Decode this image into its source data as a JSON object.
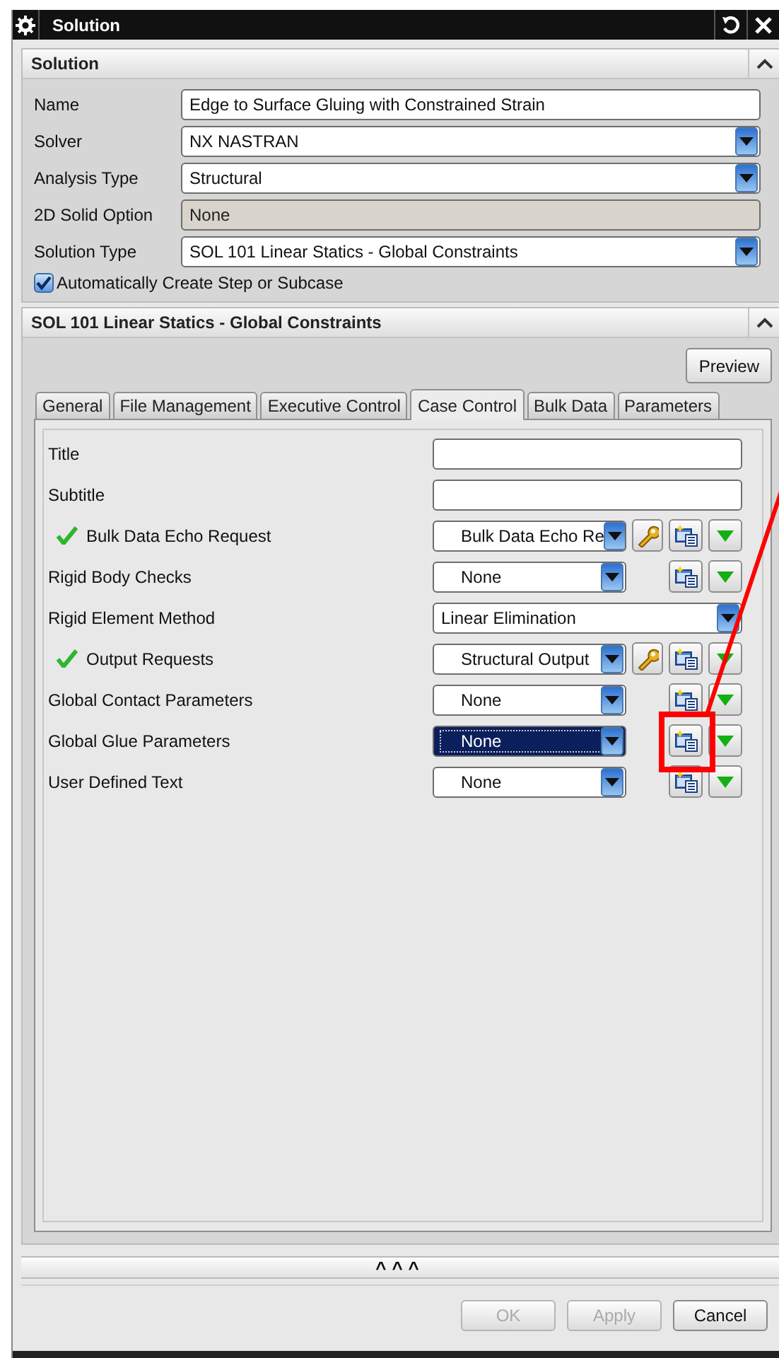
{
  "window": {
    "title": "Solution"
  },
  "solution_section": {
    "title": "Solution",
    "expanded": true,
    "fields": [
      {
        "label": "Name",
        "kind": "text",
        "value": "Edge to Surface Gluing with Constrained Strain",
        "disabled": false
      },
      {
        "label": "Solver",
        "kind": "dropdown",
        "value": "NX NASTRAN",
        "disabled": false
      },
      {
        "label": "Analysis Type",
        "kind": "dropdown",
        "value": "Structural",
        "disabled": false
      },
      {
        "label": "2D Solid Option",
        "kind": "text",
        "value": "None",
        "disabled": true
      },
      {
        "label": "Solution Type",
        "kind": "dropdown",
        "value": "SOL 101 Linear Statics - Global Constraints",
        "disabled": false
      }
    ],
    "checkbox": {
      "label": "Automatically Create Step or Subcase",
      "checked": true
    }
  },
  "type_section": {
    "title": "SOL 101 Linear Statics - Global Constraints",
    "expanded": true,
    "preview_button": "Preview",
    "tabs": [
      {
        "label": "General",
        "selected": false
      },
      {
        "label": "File Management",
        "selected": false
      },
      {
        "label": "Executive Control",
        "selected": false
      },
      {
        "label": "Case Control",
        "selected": true
      },
      {
        "label": "Bulk Data",
        "selected": false
      },
      {
        "label": "Parameters",
        "selected": false
      }
    ],
    "rows": [
      {
        "label": "Title",
        "kind": "text",
        "checked": false
      },
      {
        "label": "Subtitle",
        "kind": "text",
        "checked": false
      },
      {
        "label": "Bulk Data Echo Request",
        "kind": "modeling_object",
        "value": "Bulk Data Echo Re",
        "checked": true,
        "editable": true,
        "selected": false,
        "highlighted": false
      },
      {
        "label": "Rigid Body Checks",
        "kind": "modeling_object",
        "value": "None",
        "checked": false,
        "editable": false,
        "selected": false,
        "highlighted": false
      },
      {
        "label": "Rigid Element Method",
        "kind": "dropdown",
        "value": "Linear Elimination",
        "checked": false
      },
      {
        "label": "Output Requests",
        "kind": "modeling_object",
        "value": "Structural Output",
        "checked": true,
        "editable": true,
        "selected": false,
        "highlighted": false
      },
      {
        "label": "Global Contact Parameters",
        "kind": "modeling_object",
        "value": "None",
        "checked": false,
        "editable": false,
        "selected": false,
        "highlighted": false
      },
      {
        "label": "Global Glue Parameters",
        "kind": "modeling_object",
        "value": "None",
        "checked": false,
        "editable": false,
        "selected": true,
        "highlighted": true
      },
      {
        "label": "User Defined Text",
        "kind": "modeling_object",
        "value": "None",
        "checked": false,
        "editable": false,
        "selected": false,
        "highlighted": false
      }
    ]
  },
  "more_toggle": "^^^",
  "buttons": [
    {
      "label": "OK",
      "disabled": true
    },
    {
      "label": "Apply",
      "disabled": true
    },
    {
      "label": "Cancel",
      "disabled": false
    }
  ]
}
